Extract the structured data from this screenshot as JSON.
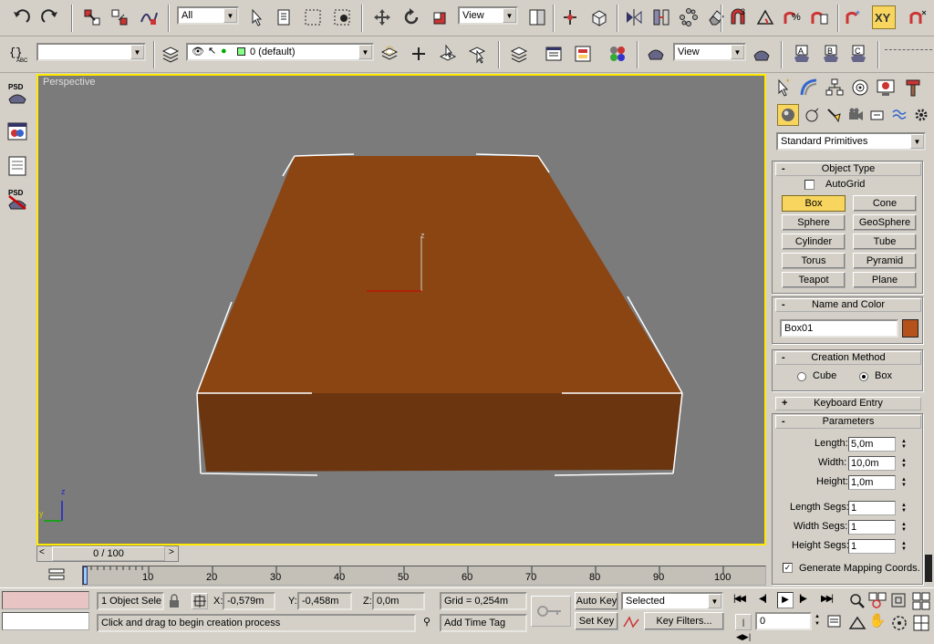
{
  "toolbar1": {
    "selection_filter": "All",
    "ref_coord": "View"
  },
  "toolbar2": {
    "named_sel_placeholder": "",
    "layer": "0 (default)",
    "render_view": "View"
  },
  "viewport": {
    "label": "Perspective",
    "object_color": "#8b4513",
    "axis_z": "z",
    "axis_y": "y"
  },
  "timeline": {
    "frame": "0 / 100",
    "ticks": [
      "10",
      "20",
      "30",
      "40",
      "50",
      "60",
      "70",
      "80",
      "90",
      "100"
    ]
  },
  "command_panel": {
    "category": "Standard Primitives",
    "object_type_title": "Object Type",
    "autogrid": "AutoGrid",
    "buttons": [
      "Box",
      "Cone",
      "Sphere",
      "GeoSphere",
      "Cylinder",
      "Tube",
      "Torus",
      "Pyramid",
      "Teapot",
      "Plane"
    ],
    "name_color_title": "Name and Color",
    "object_name": "Box01",
    "object_color": "#b5521b",
    "creation_method_title": "Creation Method",
    "method_cube": "Cube",
    "method_box": "Box",
    "keyboard_entry_title": "Keyboard Entry",
    "parameters_title": "Parameters",
    "length_label": "Length:",
    "length": "5,0m",
    "width_label": "Width:",
    "width": "10,0m",
    "height_label": "Height:",
    "height": "1,0m",
    "length_segs_label": "Length Segs:",
    "length_segs": "1",
    "width_segs_label": "Width Segs:",
    "width_segs": "1",
    "height_segs_label": "Height Segs:",
    "height_segs": "1",
    "mapping": "Generate Mapping Coords."
  },
  "status": {
    "selection": "1 Object Sele",
    "x_label": "X:",
    "x": "-0,579m",
    "y_label": "Y:",
    "y": "-0,458m",
    "z_label": "Z:",
    "z": "0,0m",
    "grid": "Grid = 0,254m",
    "prompt": "Click and drag to begin creation process",
    "add_time_tag": "Add Time Tag",
    "auto_key": "Auto Key",
    "set_key": "Set Key",
    "key_mode": "Selected",
    "key_filters": "Key Filters...",
    "current_frame": "0"
  }
}
